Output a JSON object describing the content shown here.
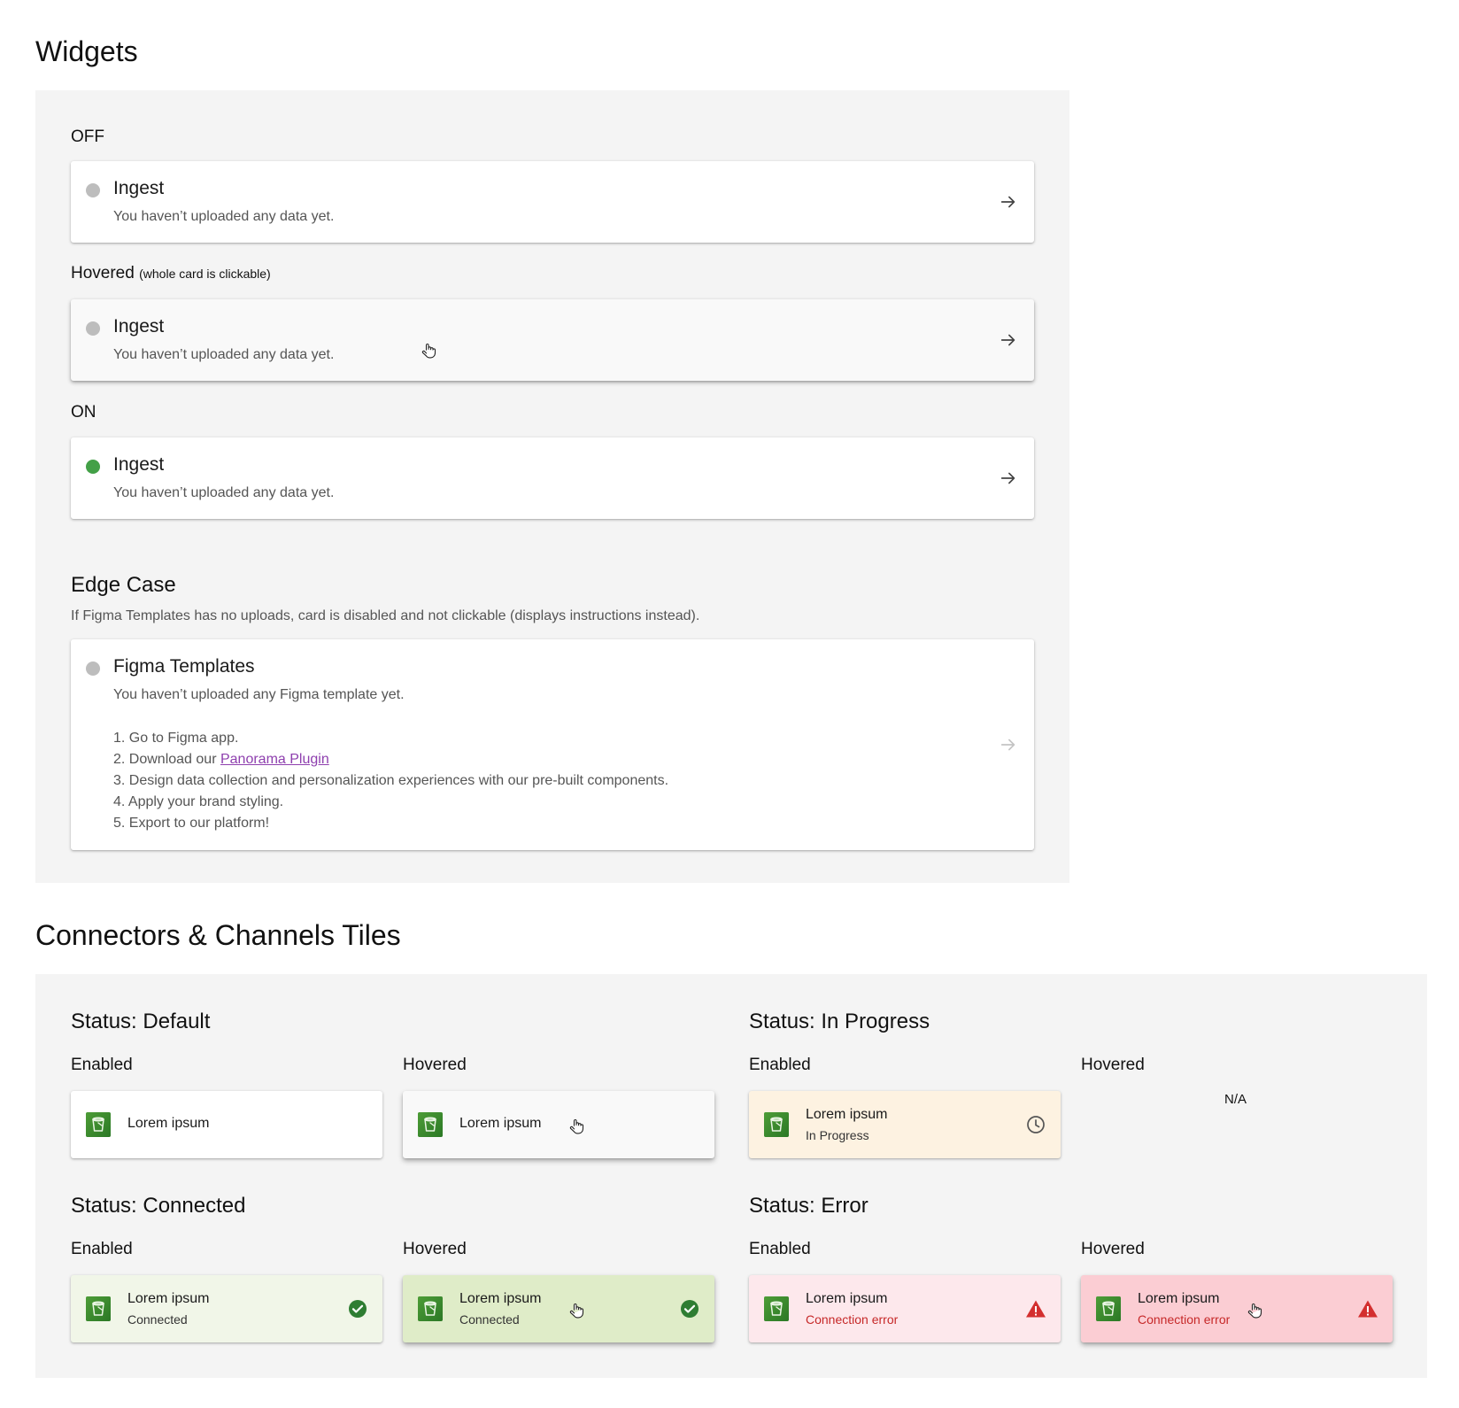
{
  "widgets": {
    "heading": "Widgets",
    "off_label": "OFF",
    "hovered_label": "Hovered",
    "hovered_note": "(whole card is clickable)",
    "on_label": "ON",
    "card_title": "Ingest",
    "card_subtitle": "You haven’t uploaded any data yet.",
    "edge_case": {
      "title": "Edge Case",
      "description": "If Figma Templates has no uploads, card is disabled and not clickable (displays instructions instead).",
      "card_title": "Figma Templates",
      "card_subtitle": "You haven’t uploaded any Figma template yet.",
      "steps": [
        "1. Go to Figma app.",
        "2. Download our ",
        "3. Design data collection and personalization experiences with our pre-built components.",
        "4. Apply your brand styling.",
        "5. Export to our platform!"
      ],
      "plugin_link": "Panorama Plugin"
    },
    "colors": {
      "off_dot": "#bdbdbd",
      "on_dot": "#43a047",
      "link": "#8e3fae"
    }
  },
  "tiles": {
    "heading": "Connectors & Channels Tiles",
    "enabled_label": "Enabled",
    "hovered_label": "Hovered",
    "tile_name": "Lorem ipsum",
    "default": {
      "title": "Status: Default"
    },
    "in_progress": {
      "title": "Status: In Progress",
      "status_text": "In Progress",
      "hovered_value": "N/A"
    },
    "connected": {
      "title": "Status: Connected",
      "status_text": "Connected"
    },
    "error": {
      "title": "Status: Error",
      "status_text": "Connection error"
    },
    "colors": {
      "in_progress_bg": "#fdf2e1",
      "connected_bg": "#f1f6e8",
      "connected_hover_bg": "#dfecc8",
      "error_bg": "#fde8ec",
      "error_hover_bg": "#fbcdd3",
      "success": "#2e7d32",
      "error": "#d32f2f"
    },
    "icons": {
      "logo": "bucket-icon",
      "progress": "clock-icon",
      "connected": "check-circle-icon",
      "error": "warning-icon"
    }
  }
}
